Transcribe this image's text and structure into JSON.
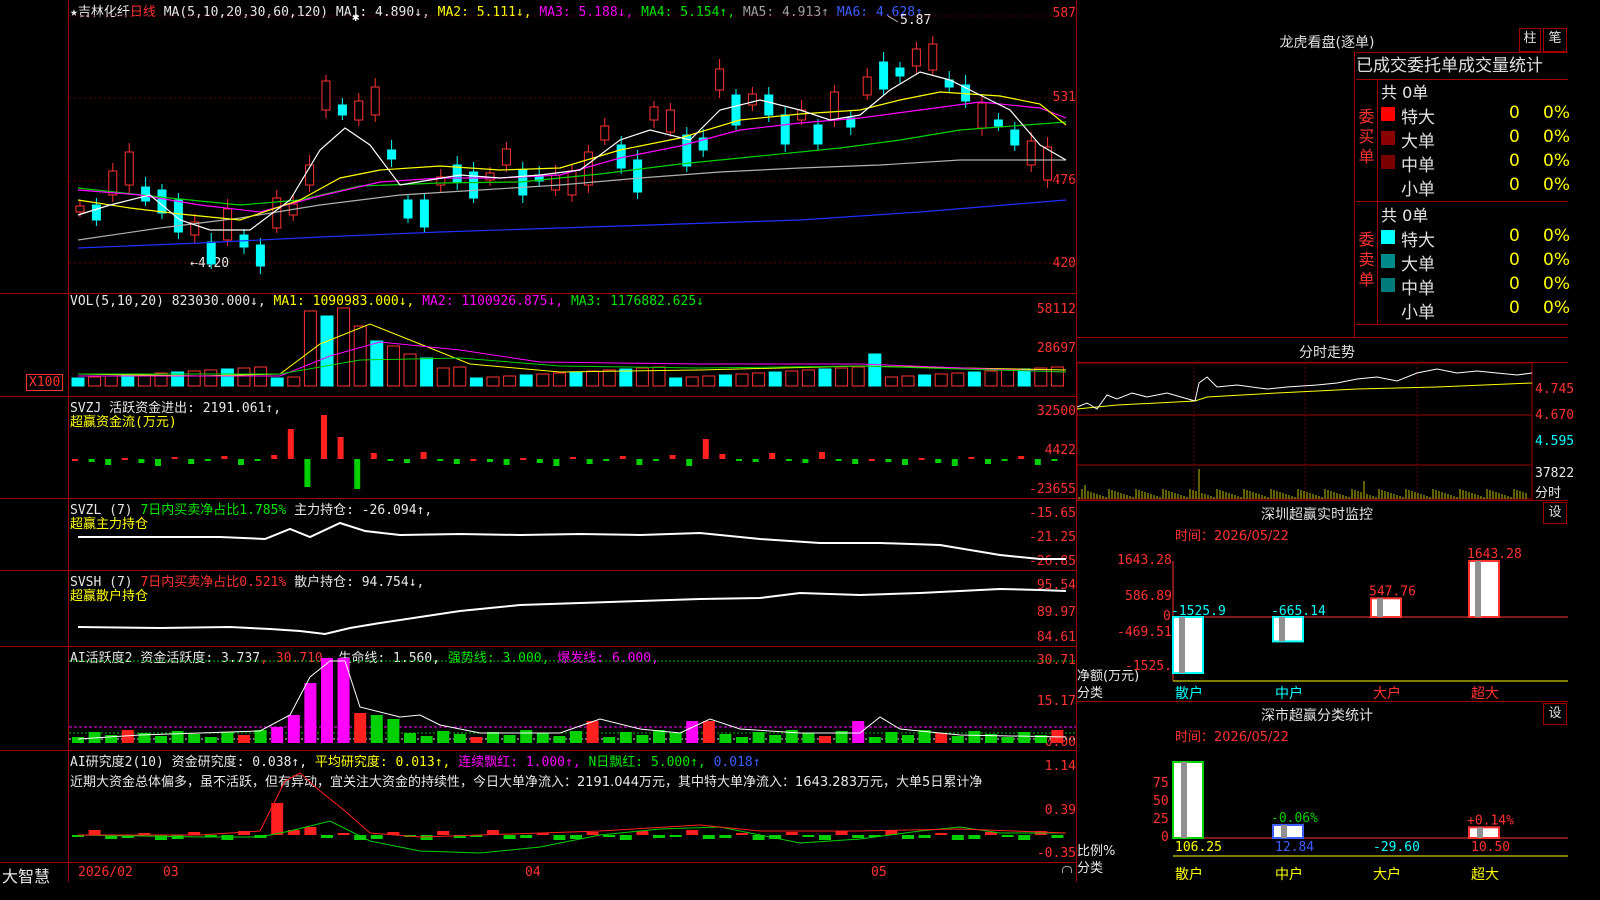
{
  "kline": {
    "title_star": "★",
    "stock_name": "吉林化纤",
    "period": "日线",
    "ma_label": "MA(5,10,20,30,60,120)",
    "ma1": "MA1: 4.890↓,",
    "ma2": "MA2: 5.111↓,",
    "ma3": "MA3: 5.188↓,",
    "ma4": "MA4: 5.154↑,",
    "ma5": "MA5: 4.913↑",
    "ma6": "MA6: 4.628↑",
    "yaxis": [
      "587",
      "531",
      "476",
      "420"
    ],
    "high_note": "5.87",
    "low_note": "←4.20"
  },
  "volume": {
    "label": "VOL(5,10,20)",
    "value": "823030.000↓,",
    "ma1": "MA1: 1090983.000↓,",
    "ma2": "MA2: 1100926.875↓,",
    "ma3": "MA3: 1176882.625↓",
    "yaxis": [
      "58112",
      "28697",
      "X100"
    ]
  },
  "svzj": {
    "label": "SVZJ",
    "value": "活跃资金进出: 2191.061↑,",
    "sub": "超赢资金流(万元)",
    "yaxis": [
      "32500",
      "4422",
      "-23655"
    ]
  },
  "svzl": {
    "label": "SVZL (7)",
    "ratio": "7日内买卖净占比1.785%",
    "value": "主力持仓: -26.094↑,",
    "sub": "超赢主力持仓",
    "yaxis": [
      "-15.65",
      "-21.25",
      "-26.85"
    ]
  },
  "svsh": {
    "label": "SVSH (7)",
    "ratio": "7日内买卖净占比0.521%",
    "value": "散户持仓: 94.754↓,",
    "sub": "超赢散户持仓",
    "yaxis": [
      "95.54",
      "89.97",
      "84.61"
    ]
  },
  "ai_active": {
    "label": "AI活跃度2",
    "v1": "资金活跃度: 3.737",
    "v2": ", 30.710,",
    "v3": "生命线: 1.560,",
    "v4": "强势线: 3.000,",
    "v5": "爆发线: 6.000,",
    "yaxis": [
      "30.71",
      "15.17",
      "0.00"
    ]
  },
  "ai_research": {
    "label": "AI研究度2(10)",
    "v1": "资金研究度: 0.038↑,",
    "v2": "平均研究度: 0.013↑,",
    "v3": "连续飘红: 1.000↑,",
    "v4": "N日飘红: 5.000↑,",
    "v5": "0.018↑",
    "comment": "近期大资金总体偏多，虽不活跃，但有异动，宜关注大资金的持续性，今日大单净流入：2191.044万元，其中特大单净流入：1643.283万元，大单5日累计净",
    "yaxis": [
      "1.14",
      "0.39",
      "-0.35"
    ]
  },
  "bottom": {
    "brand": "大智慧",
    "dates": [
      "2026/02",
      "03",
      "04",
      "05"
    ]
  },
  "dragon": {
    "title": "龙虎看盘(逐单)",
    "btn1": "柱",
    "btn2": "笔",
    "tabs": [
      "已成交",
      "委托单",
      "成交量",
      "统计"
    ],
    "buy_label": "委买单",
    "sell_label": "委卖单",
    "buy_total": "共 0单",
    "sell_total": "共 0单",
    "buy_rows": [
      {
        "name": "特大",
        "count": "0",
        "pct": "0%",
        "color": "#ff0000"
      },
      {
        "name": "大单",
        "count": "0",
        "pct": "0%",
        "color": "#8b0000"
      },
      {
        "name": "中单",
        "count": "0",
        "pct": "0%",
        "color": "#7a0000"
      },
      {
        "name": "小单",
        "count": "0",
        "pct": "0%",
        "color": ""
      }
    ],
    "sell_rows": [
      {
        "name": "特大",
        "count": "0",
        "pct": "0%",
        "color": "#00ffff"
      },
      {
        "name": "大单",
        "count": "0",
        "pct": "0%",
        "color": "#008b8b"
      },
      {
        "name": "中单",
        "count": "0",
        "pct": "0%",
        "color": "#007a7a"
      },
      {
        "name": "小单",
        "count": "0",
        "pct": "0%",
        "color": ""
      }
    ]
  },
  "intraday": {
    "title": "分时走势",
    "yaxis": [
      "4.745",
      "4.670",
      "4.595"
    ],
    "vol": "37822",
    "vol_label": "分时"
  },
  "monitor": {
    "title": "深圳超赢实时监控",
    "btn": "设",
    "time": "时间：2026/05/22",
    "yaxis": [
      "1643.28",
      "586.89",
      "0",
      "-469.51",
      "-1525.9"
    ],
    "ylabel": "净额(万元)",
    "xlabel": "分类",
    "categories": [
      "散户",
      "中户",
      "大户",
      "超大"
    ],
    "bar_labels": [
      "-1525.9",
      "-665.14",
      "547.76",
      "1643.28"
    ]
  },
  "classify": {
    "title": "深市超赢分类统计",
    "btn": "设",
    "time": "时间：2026/05/22",
    "yaxis": [
      "75",
      "50",
      "25",
      "0"
    ],
    "ylabel": "比例%",
    "xlabel": "分类",
    "categories": [
      "散户",
      "中户",
      "大户",
      "超大"
    ],
    "values": [
      "106.25",
      "12.84",
      "-29.60",
      "10.50"
    ],
    "small_labels": [
      "",
      "-0.06%",
      "",
      "+0.14%"
    ]
  },
  "chart_data": [
    {
      "type": "bar",
      "title": "深圳超赢实时监控",
      "ylabel": "净额(万元)",
      "xlabel": "分类",
      "categories": [
        "散户",
        "中户",
        "大户",
        "超大"
      ],
      "values": [
        -1525.9,
        -665.14,
        547.76,
        1643.28
      ],
      "ylim": [
        -1525.9,
        1643.28
      ]
    },
    {
      "type": "bar",
      "title": "深市超赢分类统计",
      "ylabel": "比例%",
      "xlabel": "分类",
      "categories": [
        "散户",
        "中户",
        "大户",
        "超大"
      ],
      "values": [
        106.25,
        12.84,
        -29.6,
        10.5
      ],
      "ylim": [
        0,
        75
      ]
    }
  ]
}
